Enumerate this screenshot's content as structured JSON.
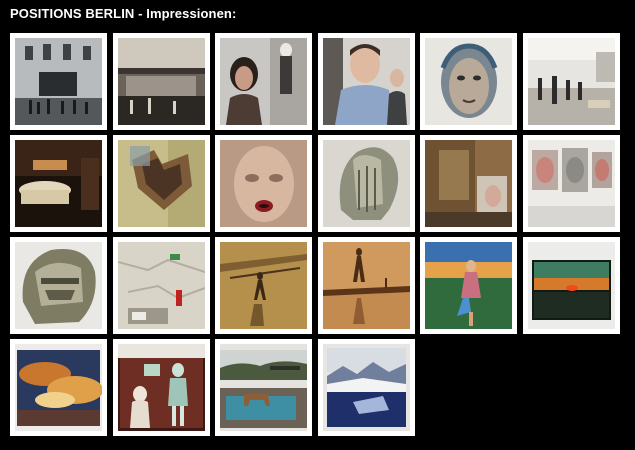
{
  "page": {
    "title": "POSITIONS BERLIN - Impressionen:"
  },
  "gallery": {
    "thumbnails": [
      {
        "subject": "building-facade-crowd"
      },
      {
        "subject": "gallery-atrium-visitors"
      },
      {
        "subject": "woman-portrait-with-wall-figure"
      },
      {
        "subject": "man-sculpture-blue-shirt"
      },
      {
        "subject": "painted-face-portrait"
      },
      {
        "subject": "exhibition-hall-visitors"
      },
      {
        "subject": "bathtub-installation-photo"
      },
      {
        "subject": "torn-paper-heart-collage"
      },
      {
        "subject": "blurred-face-red-lips"
      },
      {
        "subject": "glass-head-sculpture"
      },
      {
        "subject": "abstract-stained-painting"
      },
      {
        "subject": "face-relief-panels-on-wall"
      },
      {
        "subject": "glass-head-sculpture-closeup"
      },
      {
        "subject": "cracked-wall-fire-extinguisher"
      },
      {
        "subject": "sepia-figure-shadow"
      },
      {
        "subject": "amber-figure-reflection"
      },
      {
        "subject": "dancer-painting-sunset"
      },
      {
        "subject": "sunset-landscape-painting"
      },
      {
        "subject": "cloudy-sky-painting"
      },
      {
        "subject": "two-figures-painting"
      },
      {
        "subject": "pool-with-horse-photo"
      },
      {
        "subject": "mountain-lake-painting"
      }
    ]
  }
}
